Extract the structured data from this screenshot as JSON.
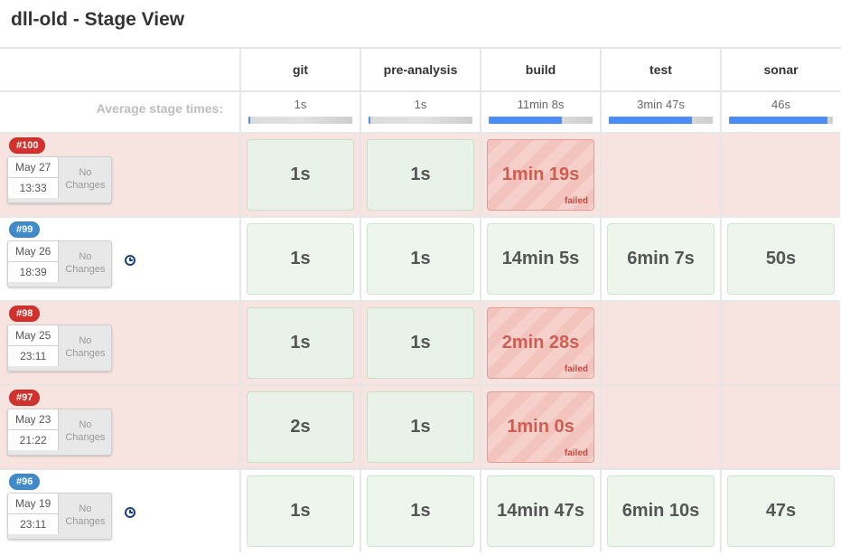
{
  "title": "dll-old - Stage View",
  "avg_label": "Average stage times:",
  "failed_label": "failed",
  "no_changes_label": "No Changes",
  "columns": [
    {
      "id": "git",
      "label": "git",
      "avg": "1s",
      "avg_pct": 2
    },
    {
      "id": "pre-analysis",
      "label": "pre-analysis",
      "avg": "1s",
      "avg_pct": 2
    },
    {
      "id": "build",
      "label": "build",
      "avg": "11min 8s",
      "avg_pct": 70
    },
    {
      "id": "test",
      "label": "test",
      "avg": "3min 47s",
      "avg_pct": 80
    },
    {
      "id": "sonar",
      "label": "sonar",
      "avg": "46s",
      "avg_pct": 95
    }
  ],
  "builds": [
    {
      "id": "#100",
      "status": "failed",
      "date": "May 27",
      "time": "13:33",
      "changes": "none",
      "clock": false,
      "cells": [
        {
          "text": "1s",
          "style": "green"
        },
        {
          "text": "1s",
          "style": "green"
        },
        {
          "text": "1min 19s",
          "style": "red",
          "failed": true
        },
        {
          "text": "",
          "style": "empty"
        },
        {
          "text": "",
          "style": "empty"
        }
      ]
    },
    {
      "id": "#99",
      "status": "success",
      "date": "May 26",
      "time": "18:39",
      "changes": "none",
      "clock": true,
      "cells": [
        {
          "text": "1s",
          "style": "greenlite"
        },
        {
          "text": "1s",
          "style": "greenlite"
        },
        {
          "text": "14min 5s",
          "style": "greenlite"
        },
        {
          "text": "6min 7s",
          "style": "greenlite"
        },
        {
          "text": "50s",
          "style": "greenlite"
        }
      ]
    },
    {
      "id": "#98",
      "status": "failed",
      "date": "May 25",
      "time": "23:11",
      "changes": "none",
      "clock": false,
      "cells": [
        {
          "text": "1s",
          "style": "green"
        },
        {
          "text": "1s",
          "style": "green"
        },
        {
          "text": "2min 28s",
          "style": "red",
          "failed": true
        },
        {
          "text": "",
          "style": "empty"
        },
        {
          "text": "",
          "style": "empty"
        }
      ]
    },
    {
      "id": "#97",
      "status": "failed",
      "date": "May 23",
      "time": "21:22",
      "changes": "none",
      "clock": false,
      "cells": [
        {
          "text": "2s",
          "style": "green"
        },
        {
          "text": "1s",
          "style": "green"
        },
        {
          "text": "1min 0s",
          "style": "red",
          "failed": true
        },
        {
          "text": "",
          "style": "empty"
        },
        {
          "text": "",
          "style": "empty"
        }
      ]
    },
    {
      "id": "#96",
      "status": "success",
      "date": "May 19",
      "time": "23:11",
      "changes": "none",
      "clock": true,
      "cells": [
        {
          "text": "1s",
          "style": "greenlite"
        },
        {
          "text": "1s",
          "style": "greenlite"
        },
        {
          "text": "14min 47s",
          "style": "greenlite"
        },
        {
          "text": "6min 10s",
          "style": "greenlite"
        },
        {
          "text": "47s",
          "style": "greenlite"
        }
      ]
    }
  ]
}
